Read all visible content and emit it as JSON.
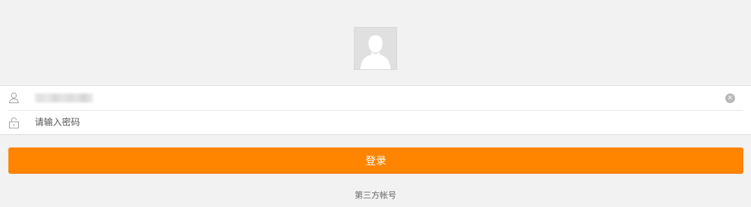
{
  "avatar": {
    "icon": "default-user-avatar-icon"
  },
  "login_form": {
    "username": {
      "icon": "user-icon",
      "value_masked": true,
      "clear_icon": "clear-circle-icon",
      "clear_glyph": "×"
    },
    "password": {
      "icon": "lock-icon",
      "placeholder": "请输入密码"
    }
  },
  "login_button": {
    "label": "登录",
    "color": "#ff8400"
  },
  "third_party": {
    "label": "第三方帐号"
  }
}
